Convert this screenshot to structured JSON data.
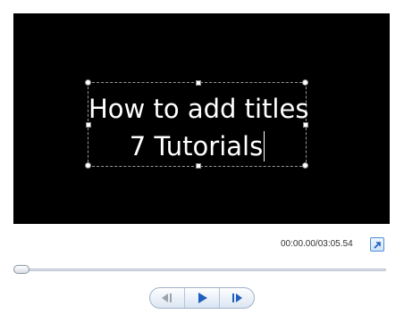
{
  "preview": {
    "title_line_1": "How to add titles",
    "title_line_2": "7 Tutorials"
  },
  "playback": {
    "time_readout": "00:00.00/03:05.54",
    "progress_fraction": 0.0
  },
  "controls": {
    "previous_icon": "previous-frame-icon",
    "play_icon": "play-icon",
    "next_icon": "next-frame-icon",
    "fullscreen_icon": "fullscreen-icon"
  },
  "colors": {
    "preview_background": "#000000",
    "accent": "#1f5fbf",
    "disabled": "#9aa3ad"
  }
}
